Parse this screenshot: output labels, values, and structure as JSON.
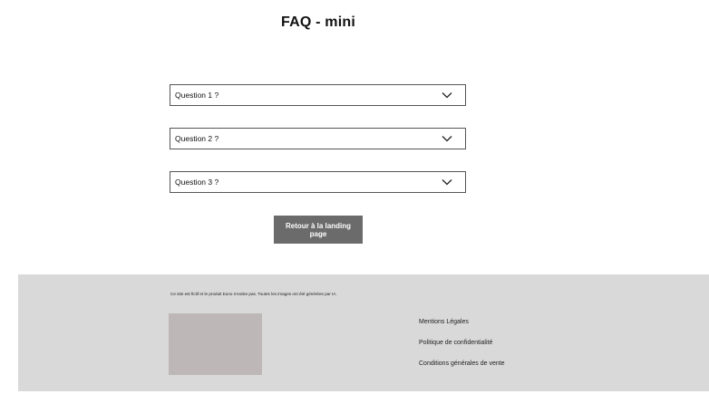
{
  "page": {
    "title": "FAQ  - mini"
  },
  "faq": {
    "questions": [
      {
        "label": "Question 1 ?",
        "icon": "chevron-down-icon"
      },
      {
        "label": "Question 2 ?",
        "icon": "chevron-down-icon"
      },
      {
        "label": "Question 3 ?",
        "icon": "chevron-down-icon"
      }
    ]
  },
  "actions": {
    "back_label": "Retour à la landing page"
  },
  "footer": {
    "disclaimer": "Ce site est fictif et le produit Euno n'existe pas. Toutes les images ont été générées par IA.",
    "links": [
      {
        "label": "Mentions Légales"
      },
      {
        "label": "Politique de confidentialité"
      },
      {
        "label": "Conditions générales de vente"
      }
    ]
  },
  "colors": {
    "button_bg": "#6b6b6b",
    "footer_bg": "#d9d9d9",
    "image_placeholder": "#bdb8b7",
    "border": "#555555"
  }
}
